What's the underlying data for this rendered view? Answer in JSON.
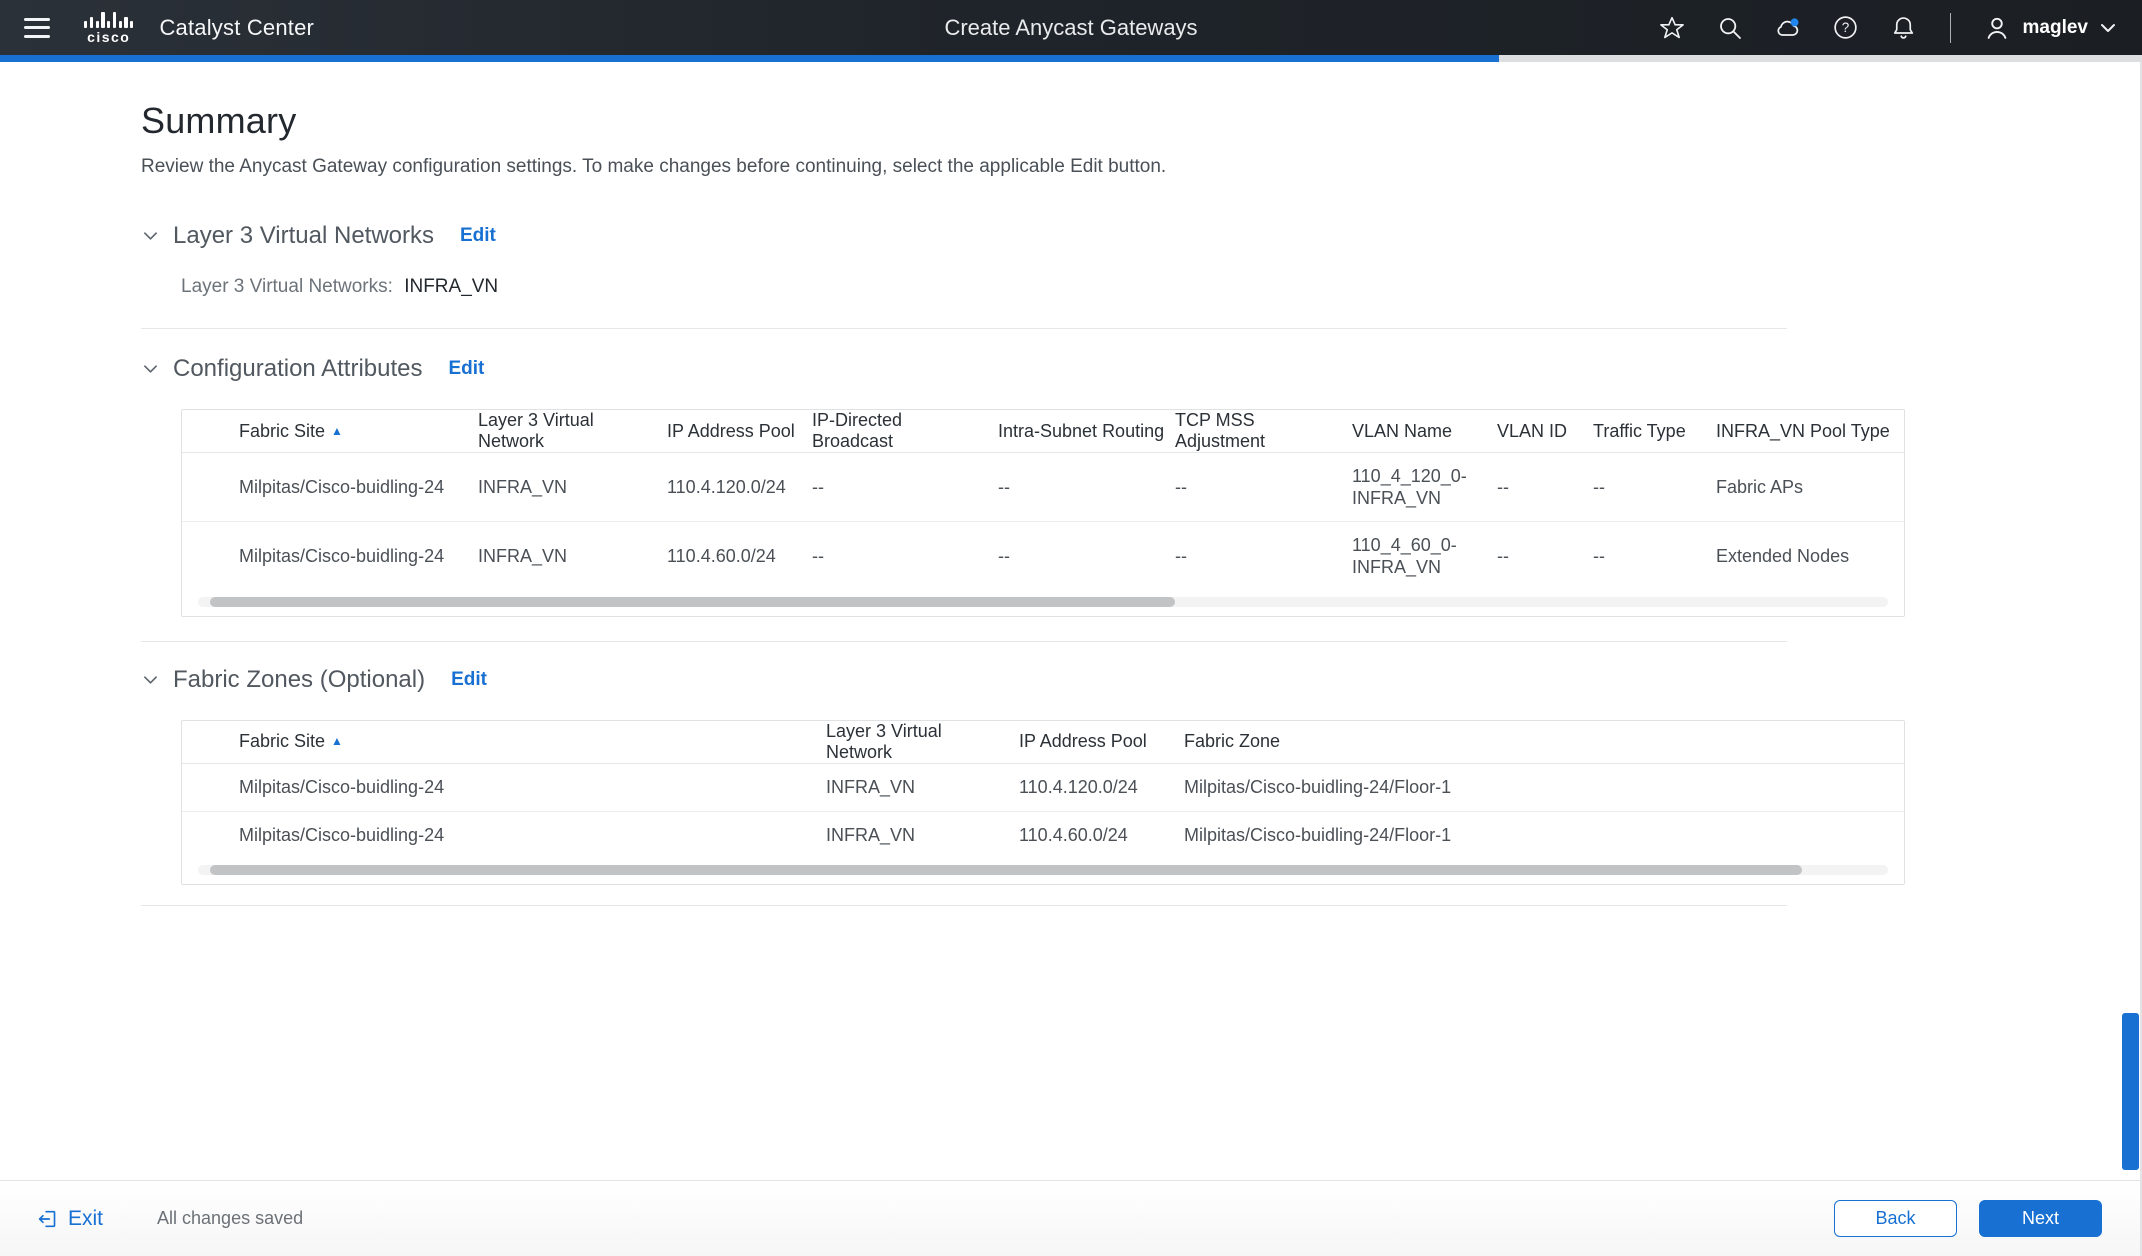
{
  "app": {
    "brand": "cisco",
    "product": "Catalyst Center",
    "page_title": "Create Anycast Gateways",
    "user_name": "maglev"
  },
  "progress_percent": 70,
  "summary": {
    "title": "Summary",
    "description": "Review the Anycast Gateway configuration settings. To make changes before continuing, select the applicable Edit button."
  },
  "sections": {
    "layer3_virtual_networks": {
      "title": "Layer 3 Virtual Networks",
      "edit_label": "Edit",
      "field_label": "Layer 3 Virtual Networks:",
      "field_value": "INFRA_VN"
    },
    "configuration_attributes": {
      "title": "Configuration Attributes",
      "edit_label": "Edit",
      "columns": [
        "Fabric Site",
        "Layer 3 Virtual Network",
        "IP Address Pool",
        "IP-Directed Broadcast",
        "Intra-Subnet Routing",
        "TCP MSS Adjustment",
        "VLAN Name",
        "VLAN ID",
        "Traffic Type",
        "INFRA_VN Pool Type"
      ],
      "rows": [
        [
          "Milpitas/Cisco-buidling-24",
          "INFRA_VN",
          "110.4.120.0/24",
          "--",
          "--",
          "--",
          "110_4_120_0-INFRA_VN",
          "--",
          "--",
          "Fabric APs"
        ],
        [
          "Milpitas/Cisco-buidling-24",
          "INFRA_VN",
          "110.4.60.0/24",
          "--",
          "--",
          "--",
          "110_4_60_0-INFRA_VN",
          "--",
          "--",
          "Extended Nodes"
        ]
      ]
    },
    "fabric_zones": {
      "title": "Fabric Zones (Optional)",
      "edit_label": "Edit",
      "columns": [
        "Fabric Site",
        "Layer 3 Virtual Network",
        "IP Address Pool",
        "Fabric Zone"
      ],
      "rows": [
        [
          "Milpitas/Cisco-buidling-24",
          "INFRA_VN",
          "110.4.120.0/24",
          "Milpitas/Cisco-buidling-24/Floor-1"
        ],
        [
          "Milpitas/Cisco-buidling-24",
          "INFRA_VN",
          "110.4.60.0/24",
          "Milpitas/Cisco-buidling-24/Floor-1"
        ]
      ]
    }
  },
  "footer": {
    "exit_label": "Exit",
    "status_text": "All changes saved",
    "back_label": "Back",
    "next_label": "Next"
  },
  "colors": {
    "accent_blue": "#1770d2",
    "header_bg": "#23282e"
  }
}
